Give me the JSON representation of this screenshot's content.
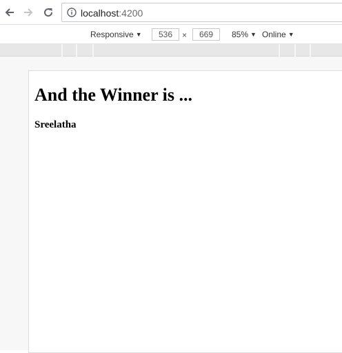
{
  "browser": {
    "url_host": "localhost",
    "url_port": ":4200"
  },
  "icons": {
    "back": "arrow-left-icon",
    "forward": "arrow-right-icon",
    "reload": "reload-icon",
    "site_info": "info-icon"
  },
  "device_toolbar": {
    "mode_label": "Responsive",
    "width": "536",
    "times_sign": "×",
    "height": "669",
    "zoom_label": "85%",
    "network_label": "Online",
    "dropdown_arrow": "▼"
  },
  "page": {
    "heading": "And the Winner is ...",
    "winner_name": "Sreelatha"
  },
  "colors": {
    "toolbar_bg": "#ffffff",
    "ruler_bg": "#e7e7e7",
    "viewport_bg": "#f7f7f7",
    "text": "#000000"
  }
}
